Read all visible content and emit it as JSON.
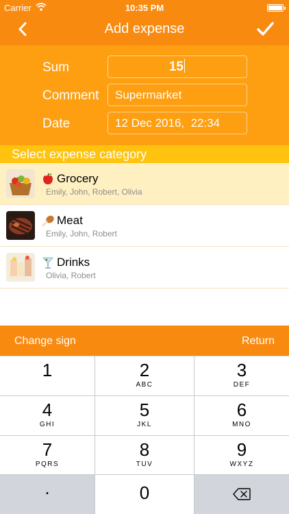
{
  "status_bar": {
    "carrier": "Carrier",
    "time": "10:35 PM"
  },
  "nav": {
    "title": "Add expense",
    "back_icon": "chevron-left-icon",
    "done_icon": "checkmark-icon"
  },
  "form": {
    "sum_label": "Sum",
    "sum_value": "15",
    "comment_label": "Comment",
    "comment_value": "Supermarket",
    "date_label": "Date",
    "date_value": "12 Dec 2016,  22:34"
  },
  "category_header": "Select expense category",
  "categories": [
    {
      "emoji": "🍎",
      "name": "Grocery",
      "people": "Emily, John, Robert, Olivia",
      "selected": true
    },
    {
      "emoji": "🍗",
      "name": "Meat",
      "people": "Emily, John, Robert",
      "selected": false
    },
    {
      "emoji": "🍸",
      "name": "Drinks",
      "people": "Olivia, Robert",
      "selected": false
    }
  ],
  "keypad_bar": {
    "change_sign": "Change sign",
    "return": "Return"
  },
  "keys": [
    {
      "digit": "1",
      "letters": ""
    },
    {
      "digit": "2",
      "letters": "ABC"
    },
    {
      "digit": "3",
      "letters": "DEF"
    },
    {
      "digit": "4",
      "letters": "GHI"
    },
    {
      "digit": "5",
      "letters": "JKL"
    },
    {
      "digit": "6",
      "letters": "MNO"
    },
    {
      "digit": "7",
      "letters": "PQRS"
    },
    {
      "digit": "8",
      "letters": "TUV"
    },
    {
      "digit": "9",
      "letters": "WXYZ"
    },
    {
      "digit": ".",
      "letters": ""
    },
    {
      "digit": "0",
      "letters": ""
    }
  ],
  "colors": {
    "accent": "#f98a10",
    "form_bg": "#fe9e11",
    "section": "#ffc30f",
    "selected_row": "#fff0c2"
  }
}
